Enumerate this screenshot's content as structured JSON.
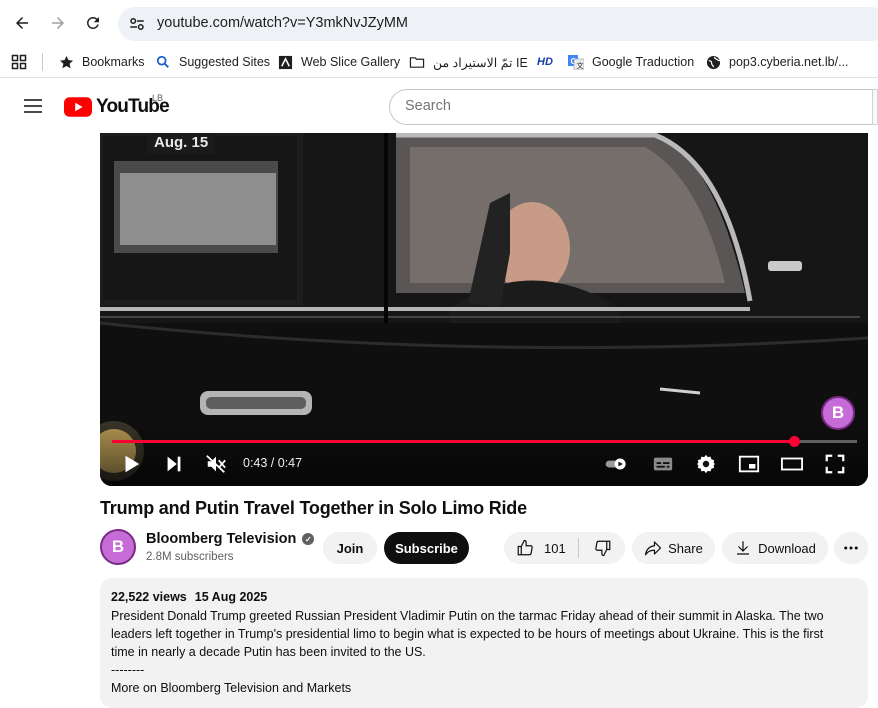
{
  "browser": {
    "url": "youtube.com/watch?v=Y3mkNvJZyMM",
    "bookmarks": [
      {
        "label": "Bookmarks",
        "icon": "star-icon"
      },
      {
        "label": "Suggested Sites",
        "icon": "search-icon"
      },
      {
        "label": "Web Slice Gallery",
        "icon": "web-slice-icon"
      },
      {
        "label": "تمّ الاستيراد من IE",
        "icon": "folder-icon"
      },
      {
        "label": "",
        "icon": "hd-icon"
      },
      {
        "label": "Google Traduction",
        "icon": "translate-icon"
      },
      {
        "label": "pop3.cyberia.net.lb/...",
        "icon": "globe-icon"
      }
    ],
    "hd_badge": "HD"
  },
  "header": {
    "logo_text": "YouTube",
    "country_code": "LB",
    "search_placeholder": "Search"
  },
  "player": {
    "date_tag": "Aug. 15",
    "watermark": "B",
    "current_time": "0:43",
    "duration": "0:47",
    "time_display": "0:43 / 0:47",
    "progress_fraction": 0.915,
    "muted": true,
    "autoplay_on": true
  },
  "video": {
    "title": "Trump and Putin Travel Together in Solo Limo Ride",
    "channel": {
      "avatar_letter": "B",
      "name": "Bloomberg Television",
      "subscribers": "2.8M subscribers",
      "verified": true
    },
    "actions": {
      "join": "Join",
      "subscribe": "Subscribe",
      "likes": "101",
      "share": "Share",
      "download": "Download"
    },
    "description": {
      "views": "22,522 views",
      "date": "15 Aug 2025",
      "lines": [
        "President Donald Trump greeted Russian President Vladimir Putin on the tarmac Friday ahead of their summit in Alaska. The two",
        "leaders left together in Trump's presidential limo to begin what is expected to be hours of meetings about Ukraine. This is the first",
        "time in nearly a decade Putin has been invited to the US.",
        "--------",
        "More on Bloomberg Television and Markets"
      ]
    }
  },
  "colors": {
    "brand_red": "#ff0000",
    "progress_red": "#ff0033",
    "bloomberg_purple": "#c56cd6"
  }
}
